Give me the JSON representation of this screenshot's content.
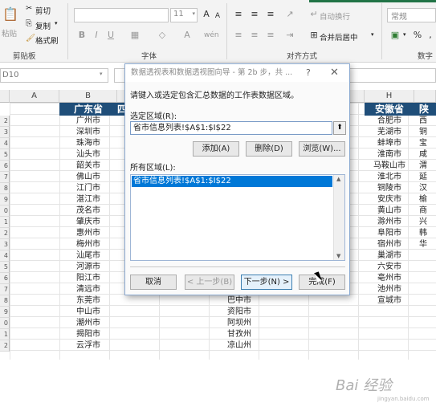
{
  "ribbon": {
    "paste_label": "粘贴",
    "cut_label": "剪切",
    "copy_label": "复制",
    "format_painter_label": "格式刷",
    "clipboard_group": "剪贴板",
    "font_size": "11",
    "font_group": "字体",
    "bold": "B",
    "italic": "I",
    "underline": "U",
    "wrap_text": "自动换行",
    "merge_center": "合并后居中",
    "align_group": "对齐方式",
    "number_format": "常规",
    "percent": "%",
    "number_group": "数字",
    "accent_color": "#217346"
  },
  "formula_bar": {
    "name_box": "D10"
  },
  "grid": {
    "column_headers": [
      "A",
      "B",
      "H"
    ],
    "header_row": {
      "guangdong": "广东省",
      "sichuan_partial": "四",
      "anhui": "安徽省",
      "shaanxi_partial": "陕"
    },
    "row_numbers": [
      "2",
      "3",
      "4",
      "5",
      "6",
      "7",
      "8",
      "9",
      "0",
      "1",
      "2",
      "3",
      "4",
      "5",
      "6",
      "7",
      "8",
      "9",
      "0",
      "1",
      "2"
    ],
    "guangdong_cities": [
      "广州市",
      "深圳市",
      "珠海市",
      "汕头市",
      "韶关市",
      "佛山市",
      "江门市",
      "湛江市",
      "茂名市",
      "肇庆市",
      "惠州市",
      "梅州市",
      "汕尾市",
      "河源市",
      "阳江市",
      "清远市",
      "东莞市",
      "中山市",
      "潮州市",
      "揭阳市",
      "云浮市"
    ],
    "sichuan_partial_cities": [
      "巴中市",
      "资阳市",
      "阿坝州",
      "甘孜州",
      "凉山州"
    ],
    "anhui_cities": [
      "合肥市",
      "芜湖市",
      "蚌埠市",
      "淮南市",
      "马鞍山市",
      "淮北市",
      "铜陵市",
      "安庆市",
      "黄山市",
      "滁州市",
      "阜阳市",
      "宿州市",
      "巢湖市",
      "六安市",
      "亳州市",
      "池州市",
      "宣城市"
    ],
    "shaanxi_partial_cities": [
      "西",
      "铜",
      "宝",
      "咸",
      "渭",
      "延",
      "汉",
      "榆",
      "商",
      "兴",
      "韩",
      "华"
    ]
  },
  "dialog": {
    "title": "数据透视表和数据透视图向导 - 第 2b 步，共 ...",
    "help": "?",
    "close": "✕",
    "instruction": "请键入或选定包含汇总数据的工作表数据区域。",
    "selected_range_label": "选定区域(R):",
    "selected_range_value": "省市信息列表!$A$1:$I$22",
    "add_button": "添加(A)",
    "delete_button": "删除(D)",
    "browse_button": "浏览(W)...",
    "all_ranges_label": "所有区域(L):",
    "all_ranges": [
      "省市信息列表!$A$1:$I$22"
    ],
    "cancel_button": "取消",
    "back_button": "< 上一步(B)",
    "next_button": "下一步(N) >",
    "finish_button": "完成(F)"
  },
  "watermark": {
    "brand": "Bai 经验",
    "url": "jingyan.baidu.com"
  }
}
